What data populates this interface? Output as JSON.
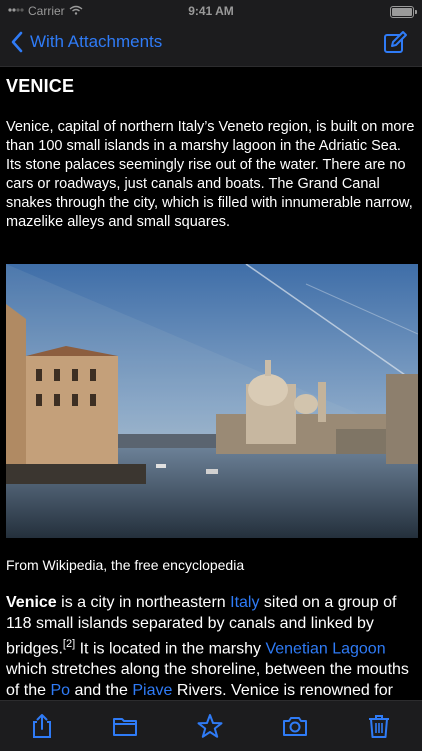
{
  "status": {
    "carrier": "Carrier",
    "time": "9:41 AM"
  },
  "nav": {
    "back_label": "With Attachments",
    "back_icon": "chevron-left-icon",
    "compose_icon": "compose-icon"
  },
  "note": {
    "title": "VENICE",
    "intro": "Venice, capital of northern Italy’s Veneto region, is built on more than 100 small islands in a marshy lagoon in the Adriatic Sea. Its stone palaces seemingly rise out of the water. There are no cars or roadways, just canals and boats. The Grand Canal snakes through the city, which is filled with innumerable narrow, mazelike alleys and small squares.",
    "source": "From Wikipedia, the free encyclopedia",
    "article": {
      "bold": "Venice",
      "t1": " is a city in northeastern ",
      "link_italy": "Italy",
      "t2": " sited on a group of 118 small islands separated by canals and linked by bridges.",
      "sup": "[2]",
      "t3": " It is located in the marshy ",
      "link_lagoon": "Venetian Lagoon",
      "t4": " which stretches along the shoreline, between the mouths of the ",
      "link_po": "Po",
      "t5": " and the ",
      "link_piave": "Piave",
      "t6": " Rivers. Venice is renowned for the beauty of its setting, its architecture"
    }
  },
  "toolbar": {
    "icons": [
      "share-icon",
      "folder-icon",
      "star-icon",
      "camera-icon",
      "trash-icon"
    ]
  },
  "colors": {
    "accent": "#2f7bf6",
    "background": "#000000",
    "bar": "#1c1c1e"
  }
}
